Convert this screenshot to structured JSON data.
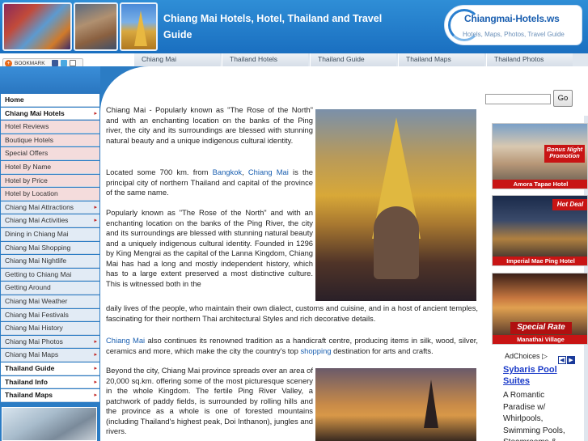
{
  "header": {
    "title": "Chiang Mai Hotels, Hotel, Thailand and Travel Guide",
    "logo_name": "Chiangmai-Hotels.ws",
    "logo_tagline": "Hotels, Maps, Photos, Travel Guide"
  },
  "nav": {
    "items": [
      "Chiang Mai",
      "Thailand Hotels",
      "Thailand Guide",
      "Thailand Maps",
      "Thailand Photos"
    ]
  },
  "bookmark": {
    "label": "BOOKMARK"
  },
  "search": {
    "value": "",
    "go_label": "Go"
  },
  "sidebar": {
    "items": [
      {
        "label": "Home",
        "style": "white",
        "arrow": false
      },
      {
        "label": "Chiang Mai Hotels",
        "style": "white",
        "arrow": true
      },
      {
        "label": "Hotel Reviews",
        "style": "sub",
        "arrow": false
      },
      {
        "label": "Boutique Hotels",
        "style": "sub",
        "arrow": false
      },
      {
        "label": "Special Offers",
        "style": "sub",
        "arrow": false
      },
      {
        "label": "Hotel By Name",
        "style": "sub",
        "arrow": false
      },
      {
        "label": "Hotel by Price",
        "style": "sub",
        "arrow": false
      },
      {
        "label": "Hotel by Location",
        "style": "sub",
        "arrow": false
      },
      {
        "label": "Chiang Mai Attractions",
        "style": "blue",
        "arrow": true
      },
      {
        "label": "Chiang Mai Activities",
        "style": "blue",
        "arrow": true
      },
      {
        "label": "Dining in Chiang Mai",
        "style": "blue",
        "arrow": false
      },
      {
        "label": "Chiang Mai Shopping",
        "style": "blue",
        "arrow": false
      },
      {
        "label": "Chiang Mai Nightlife",
        "style": "blue",
        "arrow": false
      },
      {
        "label": "Getting to Chiang Mai",
        "style": "blue",
        "arrow": false
      },
      {
        "label": "Getting Around",
        "style": "blue",
        "arrow": false
      },
      {
        "label": "Chiang Mai Weather",
        "style": "blue",
        "arrow": false
      },
      {
        "label": "Chiang Mai Festivals",
        "style": "blue",
        "arrow": false
      },
      {
        "label": "Chiang Mai History",
        "style": "blue",
        "arrow": false
      },
      {
        "label": "Chiang Mai Photos",
        "style": "blue",
        "arrow": true
      },
      {
        "label": "Chiang Mai Maps",
        "style": "blue",
        "arrow": true
      },
      {
        "label": "Thailand Guide",
        "style": "subhead",
        "arrow": true
      },
      {
        "label": "Thailand Info",
        "style": "subhead",
        "arrow": true
      },
      {
        "label": "Thailand Maps",
        "style": "subhead",
        "arrow": true
      }
    ]
  },
  "content": {
    "p1": "Chiang Mai - Popularly known as \"The Rose of the North\" and with an enchanting location on the banks of the Ping river, the city and its surroundings are blessed with stunning natural beauty and a unique indigenous cultural identity.",
    "p2_a": "Located some 700 km. from ",
    "p2_link1": "Bangkok",
    "p2_sep": ", ",
    "p2_link2": "Chiang Mai",
    "p2_b": " is the principal city of northern Thailand and capital of the province of the same name.",
    "p3": "Popularly known as \"The Rose of the North\" and with an enchanting location on the banks of the Ping River, the city and its surroundings are blessed with stunning natural beauty and a uniquely indigenous cultural identity. Founded in 1296 by King Mengrai as the capital of the Lanna Kingdom, Chiang Mai has had a long and mostly independent history, which has to a large extent preserved a most distinctive culture. This is witnessed both in the daily lives of the people, who maintain their own dialect, customs and cuisine, and in a host of ancient temples, fascinating for their northern Thai architectural Styles and rich decorative details.",
    "p4_link1": "Chiang Mai",
    "p4_a": " also continues its renowned tradition as a handicraft centre, producing items in silk, wood, silver, ceramics and more, which make the city the country's top ",
    "p4_link2": "shopping",
    "p4_b": " destination for arts and crafts.",
    "p5": "Beyond the city, Chiang Mai province spreads over an area of 20,000 sq.km. offering some of the most picturesque scenery in the whole Kingdom. The fertile Ping River Valley, a patchwork of paddy fields, is surrounded by rolling hills and the province as a whole is one of forested mountains (including Thailand's highest peak, Doi Inthanon), jungles and rivers."
  },
  "ads": [
    {
      "caption": "Amora Tapae Hotel",
      "badge": "Bonus Night Promotion"
    },
    {
      "caption": "Imperial Mae Ping Hotel",
      "badge": "Hot Deal"
    },
    {
      "caption": "Manathai Village",
      "badge": "Special Rate"
    }
  ],
  "adchoices": {
    "label": "AdChoices",
    "link": "Sybaris Pool Suites",
    "text": "A Romantic Paradise w/ Whirlpools, Swimming Pools, Steamrooms &"
  },
  "colors": {
    "brand_blue": "#2b7cc4",
    "link": "#1a5fb0",
    "ad_red": "#c81414"
  }
}
